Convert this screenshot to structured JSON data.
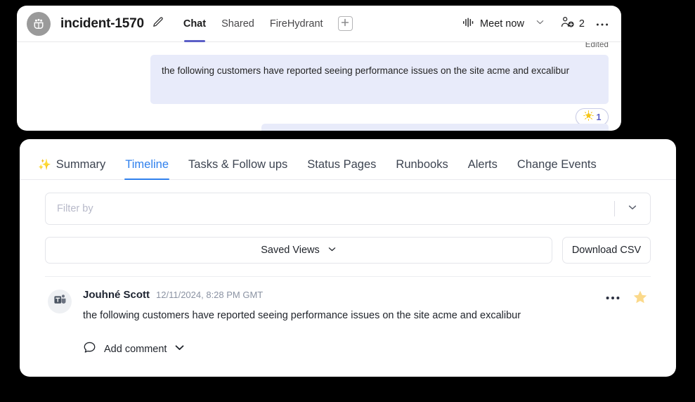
{
  "chat_window": {
    "avatar_icon": "people-group-icon",
    "title": "incident-1570",
    "edit_icon": "pencil-icon",
    "tabs": [
      {
        "label": "Chat",
        "active": true
      },
      {
        "label": "Shared",
        "active": false
      },
      {
        "label": "FireHydrant",
        "active": false
      }
    ],
    "add_tab_icon": "plus-square-icon",
    "meet_now": {
      "icon": "audio-waveform-icon",
      "label": "Meet now",
      "chevron_icon": "chevron-down-icon"
    },
    "participants": {
      "icon": "people-add-icon",
      "count": "2"
    },
    "more_icon": "ellipsis-icon",
    "active_tab_color": "#5b5fc7"
  },
  "chat_body": {
    "edited_label": "Edited",
    "message_text": "the following customers have reported seeing performance issues on the site acme and excalibur",
    "bubble_color": "#e8ebfa",
    "reaction": {
      "emoji_icon": "sparkle-star-emoji",
      "emoji": "🌟",
      "count": "1",
      "count_color": "#5b5fc7"
    }
  },
  "timeline_panel": {
    "tabs": [
      {
        "label": "Summary",
        "icon": "sparkles-icon",
        "active": false
      },
      {
        "label": "Timeline",
        "icon": "",
        "active": true
      },
      {
        "label": "Tasks & Follow ups",
        "icon": "",
        "active": false
      },
      {
        "label": "Status Pages",
        "icon": "",
        "active": false
      },
      {
        "label": "Runbooks",
        "icon": "",
        "active": false
      },
      {
        "label": "Alerts",
        "icon": "",
        "active": false
      },
      {
        "label": "Change Events",
        "icon": "",
        "active": false
      }
    ],
    "active_tab_color": "#2f80ed",
    "filter": {
      "placeholder": "Filter by",
      "value": "",
      "chevron_icon": "chevron-down-icon"
    },
    "saved_views": {
      "label": "Saved Views",
      "chevron_icon": "chevron-down-icon"
    },
    "download_csv": {
      "label": "Download CSV"
    },
    "entries": [
      {
        "avatar_icon": "microsoft-teams-icon",
        "author": "Jouhné Scott",
        "timestamp": "12/11/2024, 8:28 PM GMT",
        "text": "the following customers have reported seeing performance issues on the site acme and excalibur",
        "more_icon": "ellipsis-icon",
        "star_icon": "star-filled-icon",
        "star_color": "#fbd46d"
      }
    ],
    "add_comment": {
      "icon": "comment-bubble-icon",
      "label": "Add comment",
      "chevron_icon": "chevron-down-icon"
    }
  }
}
